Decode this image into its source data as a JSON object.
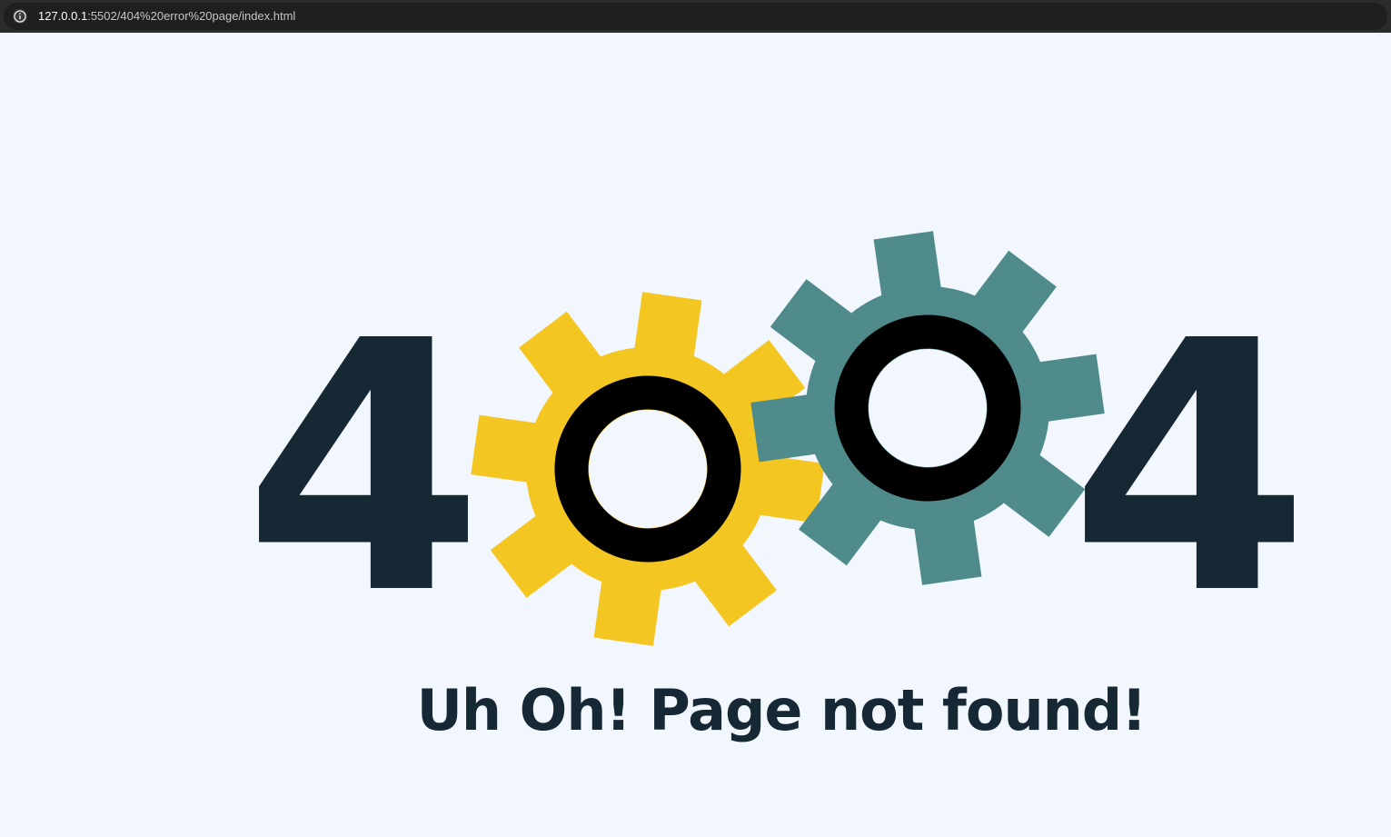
{
  "browser": {
    "url_host": "127.0.0.1",
    "url_path": ":5502/404%20error%20page/index.html",
    "icon": "info-icon"
  },
  "page": {
    "digit_left": "4",
    "digit_right": "4",
    "message": "Uh Oh! Page not found!",
    "colors": {
      "background": "#f2f6fd",
      "digits": "#162834",
      "gear_yellow": "#f4c622",
      "gear_teal": "#4f8b8a",
      "gear_ring": "#000000"
    }
  }
}
